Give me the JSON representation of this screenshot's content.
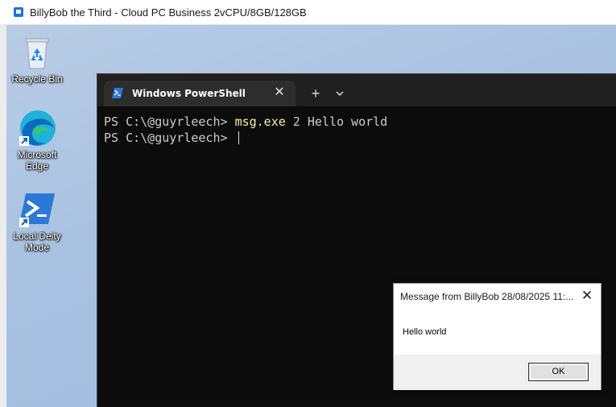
{
  "rdp": {
    "title": "BillyBob the Third - Cloud PC Business 2vCPU/8GB/128GB",
    "icon": "windows-cloud-pc-icon"
  },
  "desktop": {
    "icons": [
      {
        "label": "Recycle Bin",
        "icon": "recycle-bin-icon"
      },
      {
        "label": "Microsoft Edge",
        "icon": "edge-icon"
      },
      {
        "label": "Local Deity Mode",
        "icon": "powershell-shortcut-icon"
      }
    ]
  },
  "terminal": {
    "tab_label": "Windows PowerShell",
    "tab_close": "✕",
    "new_tab": "+",
    "lines": [
      {
        "prompt": "PS C:\\@guyrleech> ",
        "command": "msg.exe",
        "args": " 2 Hello world"
      },
      {
        "prompt": "PS C:\\@guyrleech> ",
        "command": "",
        "args": ""
      }
    ]
  },
  "message_box": {
    "title": "Message from BillyBob 28/08/2025 11:...",
    "close": "✕",
    "body": "Hello world",
    "ok_label": "OK"
  },
  "colors": {
    "desktop_bg": "#a9c2e2",
    "terminal_bg": "#0c0c0c",
    "tab_bg": "#2d2d2d",
    "command_highlight": "#f9f1a5"
  }
}
